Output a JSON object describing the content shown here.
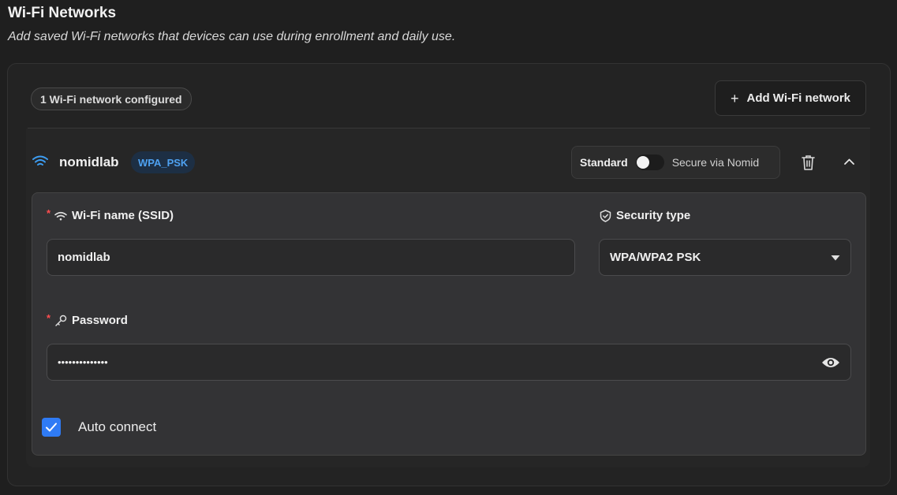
{
  "header": {
    "title": "Wi-Fi Networks",
    "subtitle": "Add saved Wi-Fi networks that devices can use during enrollment and daily use."
  },
  "toolbar": {
    "count_label": "1 Wi-Fi network configured",
    "add_label": "Add Wi-Fi network"
  },
  "network": {
    "name": "nomidlab",
    "type_badge": "WPA_PSK",
    "mode_left": "Standard",
    "mode_right": "Secure via Nomid",
    "form": {
      "ssid_label": "Wi-Fi name (SSID)",
      "ssid_value": "nomidlab",
      "security_label": "Security type",
      "security_value": "WPA/WPA2 PSK",
      "password_label": "Password",
      "password_mask": "••••••••••••••",
      "auto_connect_label": "Auto connect",
      "auto_connect_checked": true
    }
  },
  "colors": {
    "accent": "#2f7bf5",
    "badge_text": "#4ea1f0",
    "required": "#ff4d4f"
  },
  "icons": [
    "wifi-icon",
    "plus-icon",
    "trash-icon",
    "chevron-up-icon",
    "shield-icon",
    "key-icon",
    "caret-down-icon",
    "eye-icon",
    "check-icon"
  ]
}
